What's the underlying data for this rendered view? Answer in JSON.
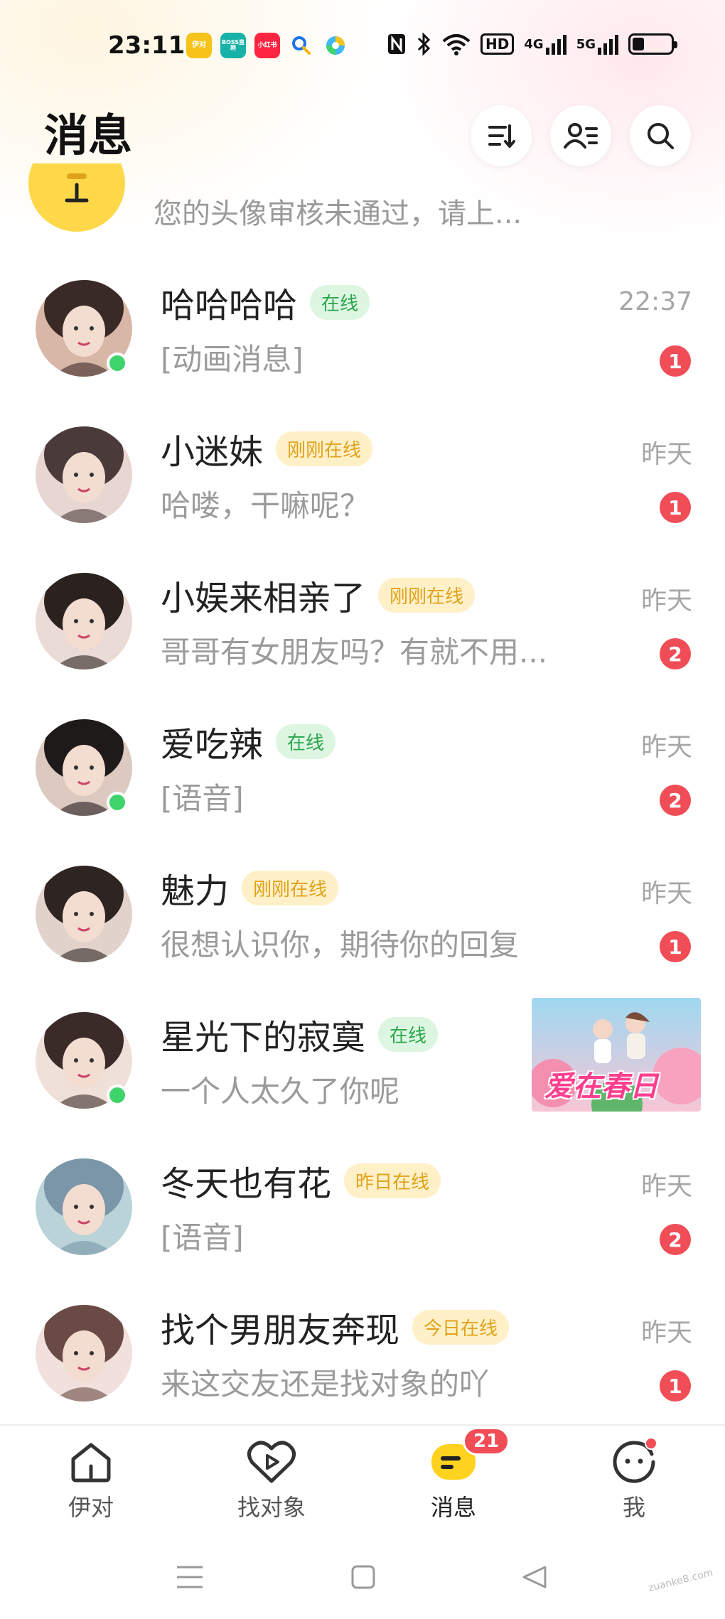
{
  "status_bar": {
    "time": "23:11",
    "apps": [
      {
        "name": "yidui-app-icon",
        "label": "伊对",
        "color": "#f7c21a"
      },
      {
        "name": "boss-app-icon",
        "label": "BOSS直聘",
        "color": "#19b2a8"
      },
      {
        "name": "xiaohongshu-app-icon",
        "label": "小红书",
        "color": "#ff2442"
      },
      {
        "name": "search-app-icon",
        "label": "",
        "color": "#1a73e8"
      },
      {
        "name": "browser-app-icon",
        "label": "",
        "color": "#3fb8f5"
      }
    ],
    "signal_4g": "4G",
    "signal_5g": "5G",
    "hd_label": "HD"
  },
  "header": {
    "title": "消息"
  },
  "notice": {
    "text": "您的头像审核未通过，请上..."
  },
  "chats": [
    {
      "name": "哈哈哈哈",
      "status": "在线",
      "status_kind": "green",
      "preview": "[动画消息]",
      "time": "22:37",
      "unread": "1",
      "online": true,
      "avatar_colors": [
        "#d9b7a7",
        "#3a2a26"
      ]
    },
    {
      "name": "小迷妹",
      "status": "刚刚在线",
      "status_kind": "yellow",
      "preview": "哈喽，干嘛呢？",
      "time": "昨天",
      "unread": "1",
      "online": false,
      "avatar_colors": [
        "#e8d6d2",
        "#4a3b3a"
      ]
    },
    {
      "name": "小娱来相亲了",
      "status": "刚刚在线",
      "status_kind": "yellow",
      "preview": "哥哥有女朋友吗？有就不用...",
      "time": "昨天",
      "unread": "2",
      "online": false,
      "avatar_colors": [
        "#eadbd6",
        "#2b2220"
      ]
    },
    {
      "name": "爱吃辣",
      "status": "在线",
      "status_kind": "green",
      "preview": "[语音]",
      "time": "昨天",
      "unread": "2",
      "online": true,
      "avatar_colors": [
        "#dcc9c0",
        "#1f1a1a"
      ]
    },
    {
      "name": "魅力",
      "status": "刚刚在线",
      "status_kind": "yellow",
      "preview": "很想认识你，期待你的回复",
      "time": "昨天",
      "unread": "1",
      "online": false,
      "avatar_colors": [
        "#e2d2cc",
        "#2e2422"
      ]
    },
    {
      "name": "星光下的寂寞",
      "status": "在线",
      "status_kind": "green",
      "preview": "一个人太久了你呢",
      "time": "",
      "unread": "",
      "online": true,
      "avatar_colors": [
        "#efe0da",
        "#3a2b28"
      ],
      "promo_text": "爱在春日"
    },
    {
      "name": "冬天也有花",
      "status": "昨日在线",
      "status_kind": "yellow",
      "preview": "[语音]",
      "time": "昨天",
      "unread": "2",
      "online": false,
      "avatar_colors": [
        "#b9d3d8",
        "#7a96a8"
      ]
    },
    {
      "name": "找个男朋友奔现",
      "status": "今日在线",
      "status_kind": "yellow",
      "preview": "来这交友还是找对象的吖",
      "time": "昨天",
      "unread": "1",
      "online": false,
      "avatar_colors": [
        "#f1e0dc",
        "#6a4a44"
      ]
    }
  ],
  "bottom_nav": {
    "items": [
      {
        "label": "伊对",
        "active": false
      },
      {
        "label": "找对象",
        "active": false
      },
      {
        "label": "消息",
        "active": true,
        "badge": "21"
      },
      {
        "label": "我",
        "active": false,
        "dot": true
      }
    ]
  },
  "watermark": "zuanke8.com"
}
